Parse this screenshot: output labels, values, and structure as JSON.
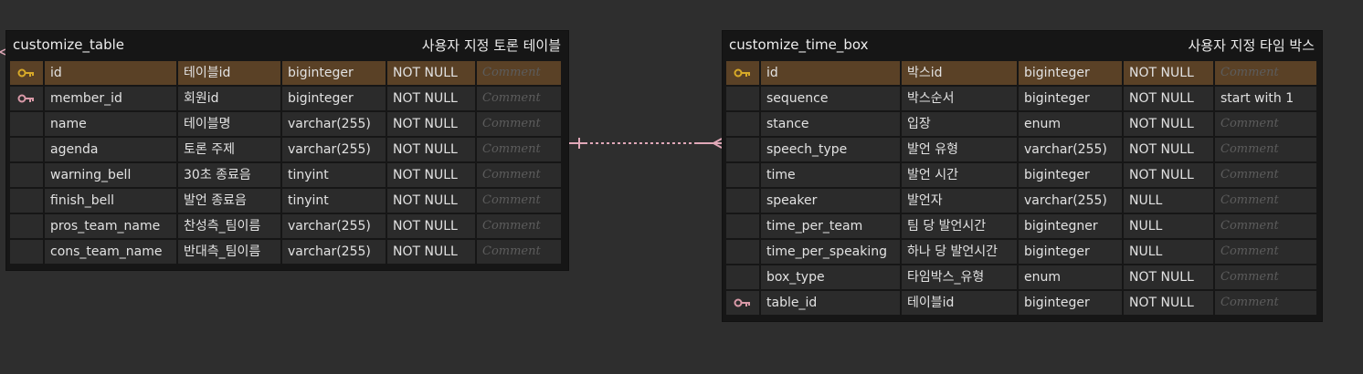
{
  "tables": [
    {
      "id": "left",
      "name": "customize_table",
      "comment": "사용자 지정 토론 테이블",
      "columns": [
        {
          "key": "primary",
          "name": "id",
          "logical": "테이블id",
          "type": "biginteger",
          "nullability": "NOT NULL",
          "comment": "Comment",
          "comment_filled": false
        },
        {
          "key": "foreign",
          "name": "member_id",
          "logical": "회원id",
          "type": "biginteger",
          "nullability": "NOT NULL",
          "comment": "Comment",
          "comment_filled": false
        },
        {
          "key": "",
          "name": "name",
          "logical": "테이블명",
          "type": "varchar(255)",
          "nullability": "NOT NULL",
          "comment": "Comment",
          "comment_filled": false
        },
        {
          "key": "",
          "name": "agenda",
          "logical": "토론 주제",
          "type": "varchar(255)",
          "nullability": "NOT NULL",
          "comment": "Comment",
          "comment_filled": false
        },
        {
          "key": "",
          "name": "warning_bell",
          "logical": "30초 종료음",
          "type": "tinyint",
          "nullability": "NOT NULL",
          "comment": "Comment",
          "comment_filled": false
        },
        {
          "key": "",
          "name": "finish_bell",
          "logical": "발언 종료음",
          "type": "tinyint",
          "nullability": "NOT NULL",
          "comment": "Comment",
          "comment_filled": false
        },
        {
          "key": "",
          "name": "pros_team_name",
          "logical": "찬성측_팀이름",
          "type": "varchar(255)",
          "nullability": "NOT NULL",
          "comment": "Comment",
          "comment_filled": false
        },
        {
          "key": "",
          "name": "cons_team_name",
          "logical": "반대측_팀이름",
          "type": "varchar(255)",
          "nullability": "NOT NULL",
          "comment": "Comment",
          "comment_filled": false
        }
      ]
    },
    {
      "id": "right",
      "name": "customize_time_box",
      "comment": "사용자 지정 타임 박스",
      "columns": [
        {
          "key": "primary",
          "name": "id",
          "logical": "박스id",
          "type": "biginteger",
          "nullability": "NOT NULL",
          "comment": "Comment",
          "comment_filled": false
        },
        {
          "key": "",
          "name": "sequence",
          "logical": "박스순서",
          "type": "biginteger",
          "nullability": "NOT NULL",
          "comment": "start with 1",
          "comment_filled": true
        },
        {
          "key": "",
          "name": "stance",
          "logical": "입장",
          "type": "enum",
          "nullability": "NOT NULL",
          "comment": "Comment",
          "comment_filled": false
        },
        {
          "key": "",
          "name": "speech_type",
          "logical": "발언 유형",
          "type": "varchar(255)",
          "nullability": "NOT NULL",
          "comment": "Comment",
          "comment_filled": false
        },
        {
          "key": "",
          "name": "time",
          "logical": "발언 시간",
          "type": "biginteger",
          "nullability": "NOT NULL",
          "comment": "Comment",
          "comment_filled": false
        },
        {
          "key": "",
          "name": "speaker",
          "logical": "발언자",
          "type": "varchar(255)",
          "nullability": "NULL",
          "comment": "Comment",
          "comment_filled": false
        },
        {
          "key": "",
          "name": "time_per_team",
          "logical": "팀 당 발언시간",
          "type": "bigintegner",
          "nullability": "NULL",
          "comment": "Comment",
          "comment_filled": false
        },
        {
          "key": "",
          "name": "time_per_speaking",
          "logical": "하나 당 발언시간",
          "type": "biginteger",
          "nullability": "NULL",
          "comment": "Comment",
          "comment_filled": false
        },
        {
          "key": "",
          "name": "box_type",
          "logical": "타임박스_유형",
          "type": "enum",
          "nullability": "NOT NULL",
          "comment": "Comment",
          "comment_filled": false
        },
        {
          "key": "foreign",
          "name": "table_id",
          "logical": "테이블id",
          "type": "biginteger",
          "nullability": "NOT NULL",
          "comment": "Comment",
          "comment_filled": false
        }
      ]
    }
  ],
  "relationship": {
    "from": "customize_table",
    "to": "customize_time_box",
    "style": "dashed",
    "color": "#e0a8b8",
    "cardinality_from": "one",
    "cardinality_to": "many"
  },
  "colors": {
    "background": "#2e2e2e",
    "table_bg": "#161616",
    "cell_bg": "#2b2b2b",
    "pk_row_bg": "#5a4126",
    "pk_key": "#d7a928",
    "fk_key": "#d99aa8",
    "placeholder_text": "#5c5c5c"
  }
}
